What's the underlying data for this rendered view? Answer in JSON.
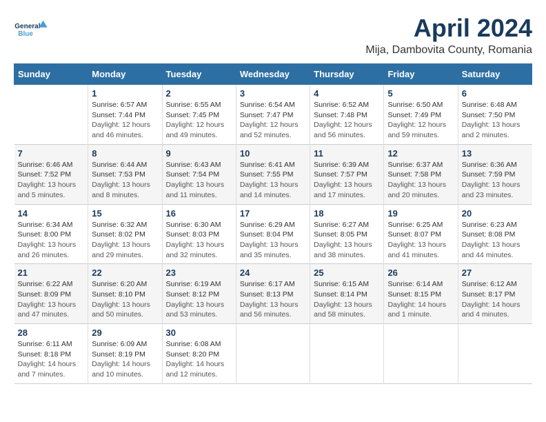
{
  "header": {
    "logo_line1": "General",
    "logo_line2": "Blue",
    "title": "April 2024",
    "subtitle": "Mija, Dambovita County, Romania"
  },
  "weekdays": [
    "Sunday",
    "Monday",
    "Tuesday",
    "Wednesday",
    "Thursday",
    "Friday",
    "Saturday"
  ],
  "weeks": [
    [
      {
        "day": "",
        "sunrise": "",
        "sunset": "",
        "daylight": ""
      },
      {
        "day": "1",
        "sunrise": "Sunrise: 6:57 AM",
        "sunset": "Sunset: 7:44 PM",
        "daylight": "Daylight: 12 hours and 46 minutes."
      },
      {
        "day": "2",
        "sunrise": "Sunrise: 6:55 AM",
        "sunset": "Sunset: 7:45 PM",
        "daylight": "Daylight: 12 hours and 49 minutes."
      },
      {
        "day": "3",
        "sunrise": "Sunrise: 6:54 AM",
        "sunset": "Sunset: 7:47 PM",
        "daylight": "Daylight: 12 hours and 52 minutes."
      },
      {
        "day": "4",
        "sunrise": "Sunrise: 6:52 AM",
        "sunset": "Sunset: 7:48 PM",
        "daylight": "Daylight: 12 hours and 56 minutes."
      },
      {
        "day": "5",
        "sunrise": "Sunrise: 6:50 AM",
        "sunset": "Sunset: 7:49 PM",
        "daylight": "Daylight: 12 hours and 59 minutes."
      },
      {
        "day": "6",
        "sunrise": "Sunrise: 6:48 AM",
        "sunset": "Sunset: 7:50 PM",
        "daylight": "Daylight: 13 hours and 2 minutes."
      }
    ],
    [
      {
        "day": "7",
        "sunrise": "Sunrise: 6:46 AM",
        "sunset": "Sunset: 7:52 PM",
        "daylight": "Daylight: 13 hours and 5 minutes."
      },
      {
        "day": "8",
        "sunrise": "Sunrise: 6:44 AM",
        "sunset": "Sunset: 7:53 PM",
        "daylight": "Daylight: 13 hours and 8 minutes."
      },
      {
        "day": "9",
        "sunrise": "Sunrise: 6:43 AM",
        "sunset": "Sunset: 7:54 PM",
        "daylight": "Daylight: 13 hours and 11 minutes."
      },
      {
        "day": "10",
        "sunrise": "Sunrise: 6:41 AM",
        "sunset": "Sunset: 7:55 PM",
        "daylight": "Daylight: 13 hours and 14 minutes."
      },
      {
        "day": "11",
        "sunrise": "Sunrise: 6:39 AM",
        "sunset": "Sunset: 7:57 PM",
        "daylight": "Daylight: 13 hours and 17 minutes."
      },
      {
        "day": "12",
        "sunrise": "Sunrise: 6:37 AM",
        "sunset": "Sunset: 7:58 PM",
        "daylight": "Daylight: 13 hours and 20 minutes."
      },
      {
        "day": "13",
        "sunrise": "Sunrise: 6:36 AM",
        "sunset": "Sunset: 7:59 PM",
        "daylight": "Daylight: 13 hours and 23 minutes."
      }
    ],
    [
      {
        "day": "14",
        "sunrise": "Sunrise: 6:34 AM",
        "sunset": "Sunset: 8:00 PM",
        "daylight": "Daylight: 13 hours and 26 minutes."
      },
      {
        "day": "15",
        "sunrise": "Sunrise: 6:32 AM",
        "sunset": "Sunset: 8:02 PM",
        "daylight": "Daylight: 13 hours and 29 minutes."
      },
      {
        "day": "16",
        "sunrise": "Sunrise: 6:30 AM",
        "sunset": "Sunset: 8:03 PM",
        "daylight": "Daylight: 13 hours and 32 minutes."
      },
      {
        "day": "17",
        "sunrise": "Sunrise: 6:29 AM",
        "sunset": "Sunset: 8:04 PM",
        "daylight": "Daylight: 13 hours and 35 minutes."
      },
      {
        "day": "18",
        "sunrise": "Sunrise: 6:27 AM",
        "sunset": "Sunset: 8:05 PM",
        "daylight": "Daylight: 13 hours and 38 minutes."
      },
      {
        "day": "19",
        "sunrise": "Sunrise: 6:25 AM",
        "sunset": "Sunset: 8:07 PM",
        "daylight": "Daylight: 13 hours and 41 minutes."
      },
      {
        "day": "20",
        "sunrise": "Sunrise: 6:23 AM",
        "sunset": "Sunset: 8:08 PM",
        "daylight": "Daylight: 13 hours and 44 minutes."
      }
    ],
    [
      {
        "day": "21",
        "sunrise": "Sunrise: 6:22 AM",
        "sunset": "Sunset: 8:09 PM",
        "daylight": "Daylight: 13 hours and 47 minutes."
      },
      {
        "day": "22",
        "sunrise": "Sunrise: 6:20 AM",
        "sunset": "Sunset: 8:10 PM",
        "daylight": "Daylight: 13 hours and 50 minutes."
      },
      {
        "day": "23",
        "sunrise": "Sunrise: 6:19 AM",
        "sunset": "Sunset: 8:12 PM",
        "daylight": "Daylight: 13 hours and 53 minutes."
      },
      {
        "day": "24",
        "sunrise": "Sunrise: 6:17 AM",
        "sunset": "Sunset: 8:13 PM",
        "daylight": "Daylight: 13 hours and 56 minutes."
      },
      {
        "day": "25",
        "sunrise": "Sunrise: 6:15 AM",
        "sunset": "Sunset: 8:14 PM",
        "daylight": "Daylight: 13 hours and 58 minutes."
      },
      {
        "day": "26",
        "sunrise": "Sunrise: 6:14 AM",
        "sunset": "Sunset: 8:15 PM",
        "daylight": "Daylight: 14 hours and 1 minute."
      },
      {
        "day": "27",
        "sunrise": "Sunrise: 6:12 AM",
        "sunset": "Sunset: 8:17 PM",
        "daylight": "Daylight: 14 hours and 4 minutes."
      }
    ],
    [
      {
        "day": "28",
        "sunrise": "Sunrise: 6:11 AM",
        "sunset": "Sunset: 8:18 PM",
        "daylight": "Daylight: 14 hours and 7 minutes."
      },
      {
        "day": "29",
        "sunrise": "Sunrise: 6:09 AM",
        "sunset": "Sunset: 8:19 PM",
        "daylight": "Daylight: 14 hours and 10 minutes."
      },
      {
        "day": "30",
        "sunrise": "Sunrise: 6:08 AM",
        "sunset": "Sunset: 8:20 PM",
        "daylight": "Daylight: 14 hours and 12 minutes."
      },
      {
        "day": "",
        "sunrise": "",
        "sunset": "",
        "daylight": ""
      },
      {
        "day": "",
        "sunrise": "",
        "sunset": "",
        "daylight": ""
      },
      {
        "day": "",
        "sunrise": "",
        "sunset": "",
        "daylight": ""
      },
      {
        "day": "",
        "sunrise": "",
        "sunset": "",
        "daylight": ""
      }
    ]
  ]
}
